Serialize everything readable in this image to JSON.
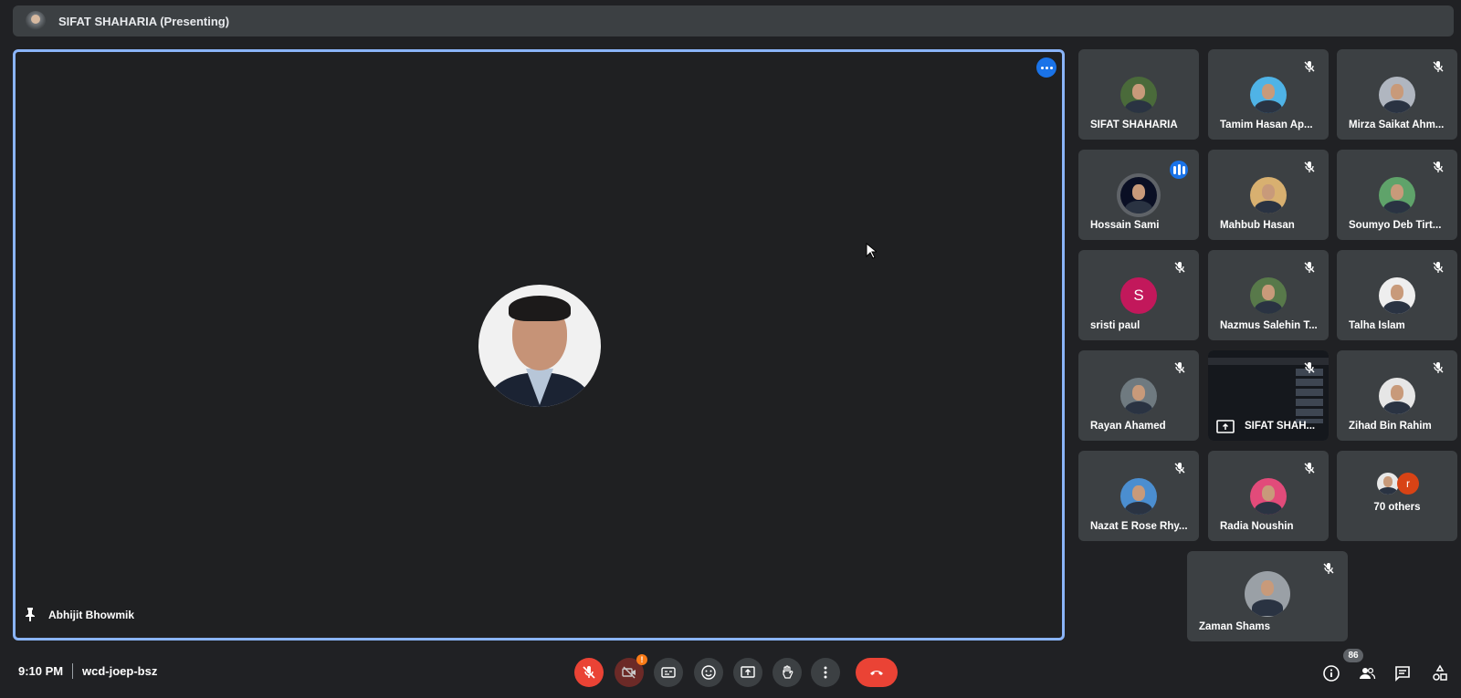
{
  "presenting": {
    "title": "SIFAT SHAHARIA (Presenting)"
  },
  "main": {
    "name": "Abhijit Bhowmik"
  },
  "participants": [
    {
      "name": "SIFAT SHAHARIA",
      "muted": false,
      "avatar_color": "#4a6a3a"
    },
    {
      "name": "Tamim Hasan Ap...",
      "muted": true,
      "avatar_color": "#4fb3e6"
    },
    {
      "name": "Mirza Saikat Ahm...",
      "muted": true,
      "avatar_color": "#b0b6c0"
    },
    {
      "name": "Hossain Sami",
      "muted": false,
      "speaking": true,
      "avatar_color": "#0a0f24"
    },
    {
      "name": "Mahbub Hasan",
      "muted": true,
      "avatar_color": "#d8b070"
    },
    {
      "name": "Soumyo Deb Tirt...",
      "muted": true,
      "avatar_color": "#5fa36a"
    },
    {
      "name": "sristi paul",
      "muted": true,
      "letter": "S"
    },
    {
      "name": "Nazmus Salehin T...",
      "muted": true,
      "avatar_color": "#58794a"
    },
    {
      "name": "Talha Islam",
      "muted": true,
      "avatar_color": "#eeeeee"
    },
    {
      "name": "Rayan Ahamed",
      "muted": true,
      "avatar_color": "#6f7a80"
    },
    {
      "name": "SIFAT SHAH...",
      "muted": true,
      "presenting_screen": true
    },
    {
      "name": "Zihad Bin Rahim",
      "muted": true,
      "avatar_color": "#e6e6e6"
    },
    {
      "name": "Nazat E Rose Rhy...",
      "muted": true,
      "avatar_color": "#4b8ed0"
    },
    {
      "name": "Radia Noushin",
      "muted": true,
      "avatar_color": "#e24b7a"
    },
    {
      "name": "Zaman Shams",
      "muted": true,
      "avatar_color": "#9aa0a6"
    }
  ],
  "others": {
    "label": "70 others",
    "letter": "r"
  },
  "bottom": {
    "time": "9:10 PM",
    "meeting_code": "wcd-joep-bsz",
    "camera_alert": "!",
    "people_count": "86"
  },
  "colors": {
    "accent": "#1a73e8",
    "danger": "#ea4335",
    "tile": "#3c4043",
    "stage_border": "#8ab4f8"
  },
  "icons": {
    "controls": [
      "mic-off-icon",
      "camera-off-icon",
      "captions-icon",
      "emoji-icon",
      "present-icon",
      "raise-hand-icon",
      "more-icon",
      "hangup-icon"
    ],
    "right": [
      "info-icon",
      "people-icon",
      "chat-icon",
      "activities-icon"
    ]
  }
}
